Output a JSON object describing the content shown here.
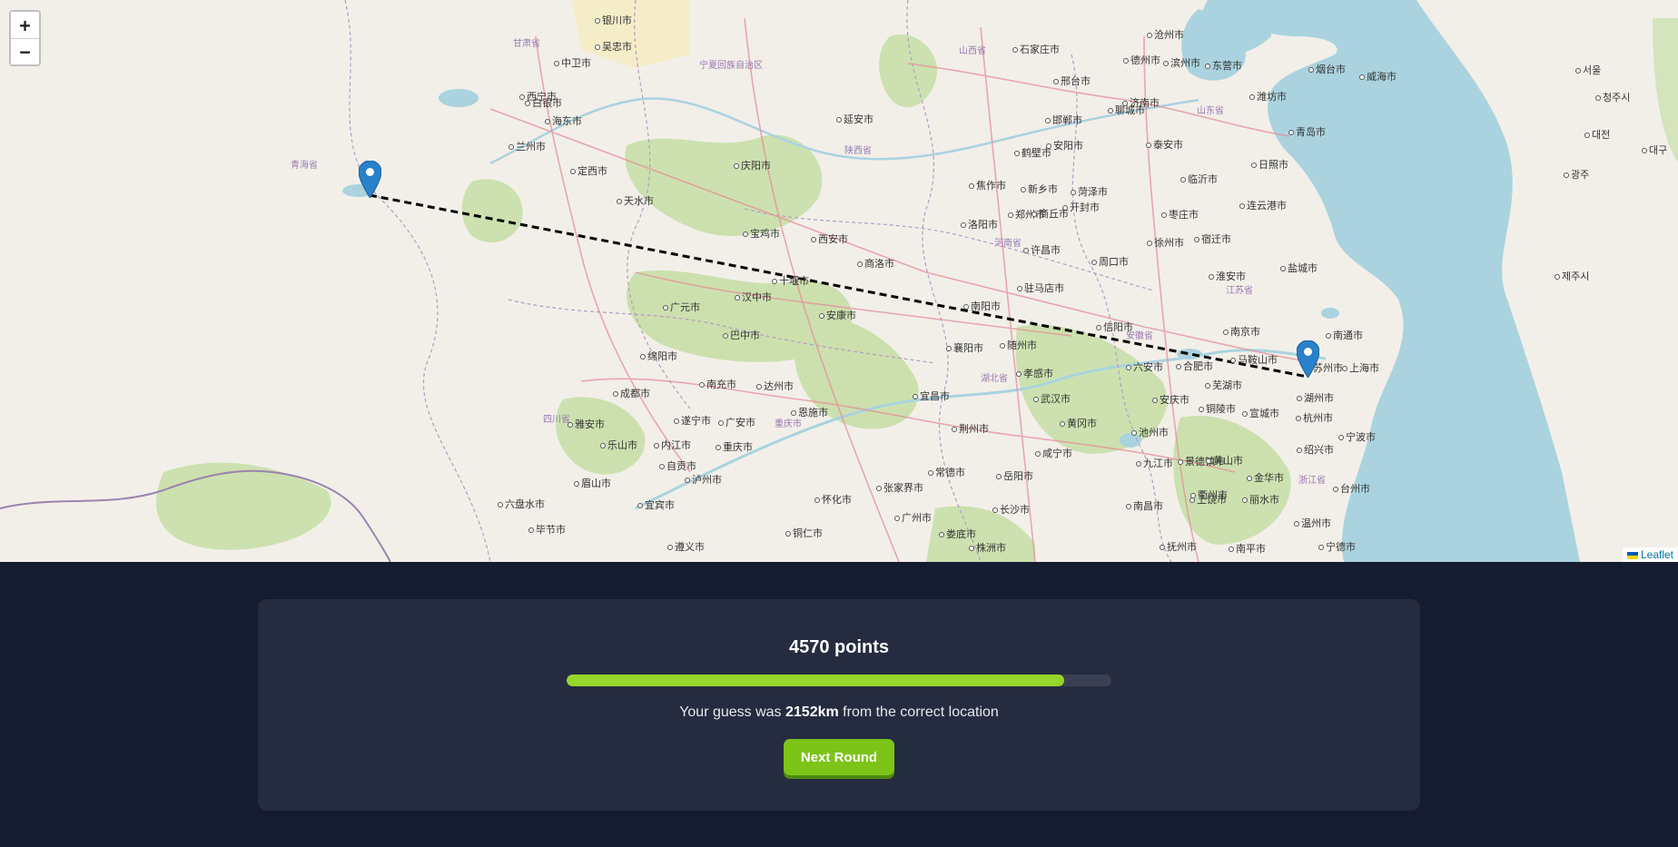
{
  "map": {
    "zoom_in_label": "+",
    "zoom_out_label": "−",
    "attribution": "Leaflet",
    "regions": [
      "甘肃省",
      "青海省",
      "宁夏回族自治区",
      "陕西省",
      "河南省",
      "山东省",
      "江苏省",
      "安徽省",
      "湖北省",
      "四川省",
      "浙江省",
      "重庆市",
      "山西省"
    ],
    "places": [
      "银川市",
      "中卫市",
      "吴忠市",
      "白银市",
      "兰州市",
      "定西市",
      "天水市",
      "庆阳市",
      "延安市",
      "西安市",
      "宝鸡市",
      "汉中市",
      "安康市",
      "商洛市",
      "南阳市",
      "洛阳市",
      "郑州市",
      "开封市",
      "许昌市",
      "周口市",
      "驻马店市",
      "信阳市",
      "六安市",
      "合肥市",
      "南京市",
      "马鞍山市",
      "芜湖市",
      "湖州市",
      "杭州市",
      "绍兴市",
      "宁波市",
      "上海市",
      "苏州市",
      "南通市",
      "盐城市",
      "淮安市",
      "宿迁市",
      "徐州市",
      "连云港市",
      "日照市",
      "青岛市",
      "烟台市",
      "威海市",
      "济南市",
      "泰安市",
      "临沂市",
      "枣庄市",
      "菏泽市",
      "商丘市",
      "新乡市",
      "焦作市",
      "鹤壁市",
      "安阳市",
      "邯郸市",
      "邢台市",
      "石家庄市",
      "沧州市",
      "德州市",
      "聊城市",
      "滨州市",
      "东营市",
      "潍坊市",
      "武汉市",
      "黄冈市",
      "随州市",
      "襄阳市",
      "十堰市",
      "宜昌市",
      "荆州市",
      "孝感市",
      "咸宁市",
      "岳阳市",
      "长沙市",
      "常德市",
      "张家界市",
      "重庆市",
      "成都市",
      "绵阳市",
      "广元市",
      "巴中市",
      "达州市",
      "南充市",
      "遂宁市",
      "广安市",
      "乐山市",
      "内江市",
      "宜宾市",
      "泸州市",
      "自贡市",
      "雅安市",
      "眉山市",
      "西宁市",
      "海东市",
      "广州市",
      "九江市",
      "南昌市",
      "景德镇市",
      "黄山市",
      "金华市",
      "台州市",
      "温州市",
      "丽水市",
      "衢州市",
      "上饶市",
      "宣城市",
      "安庆市",
      "铜陵市",
      "池州市",
      "六盘水市",
      "遵义市",
      "毕节市",
      "铜仁市",
      "恩施市",
      "怀化市",
      "娄底市",
      "株洲市",
      "抚州市",
      "南平市",
      "宁德市",
      "서울",
      "대전",
      "대구",
      "광주",
      "제주시",
      "청주시"
    ],
    "guess_marker_label": "guess-location",
    "actual_marker_label": "correct-location"
  },
  "result": {
    "points_text": "4570 points",
    "score": 4570,
    "max_score": 5000,
    "progress_fraction": 0.914,
    "distance_prefix": "Your guess was ",
    "distance_value": "2152km",
    "distance_suffix": " from the correct location",
    "next_button_label": "Next Round"
  },
  "colors": {
    "accent_green": "#7cc418",
    "panel_bg": "#262c3f",
    "page_bg": "#161c30",
    "guess_line": "#000000",
    "marker_blue": "#2a81cb"
  }
}
